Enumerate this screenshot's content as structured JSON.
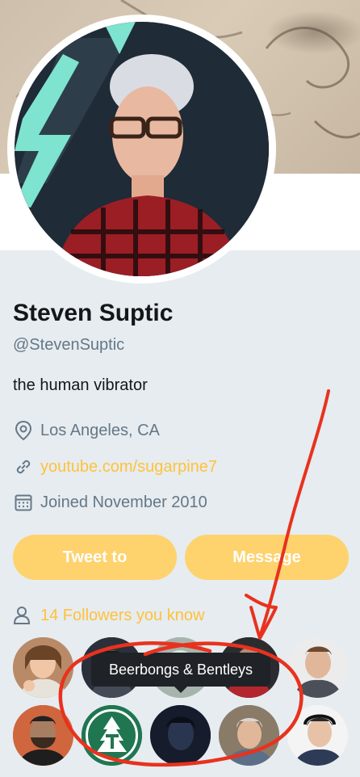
{
  "profile": {
    "name": "Steven Suptic",
    "handle": "@StevenSuptic",
    "bio": "the human vibrator",
    "location": "Los Angeles, CA",
    "website": "youtube.com/sugarpine7",
    "joined": "Joined November 2010"
  },
  "actions": {
    "tweet_to_label": "Tweet to",
    "message_label": "Message"
  },
  "followers_you_know": {
    "label": "14 Followers you know",
    "tooltip": "Beerbongs & Bentleys"
  },
  "icons": {
    "location": "map-pin-icon",
    "website": "link-icon",
    "joined": "calendar-icon",
    "followers": "person-icon"
  },
  "colors": {
    "accent": "#ffc23a",
    "button_bg": "#fed26d",
    "muted_text": "#657786",
    "page_bg": "#e6ecf0",
    "annotation": "#e8321e"
  }
}
